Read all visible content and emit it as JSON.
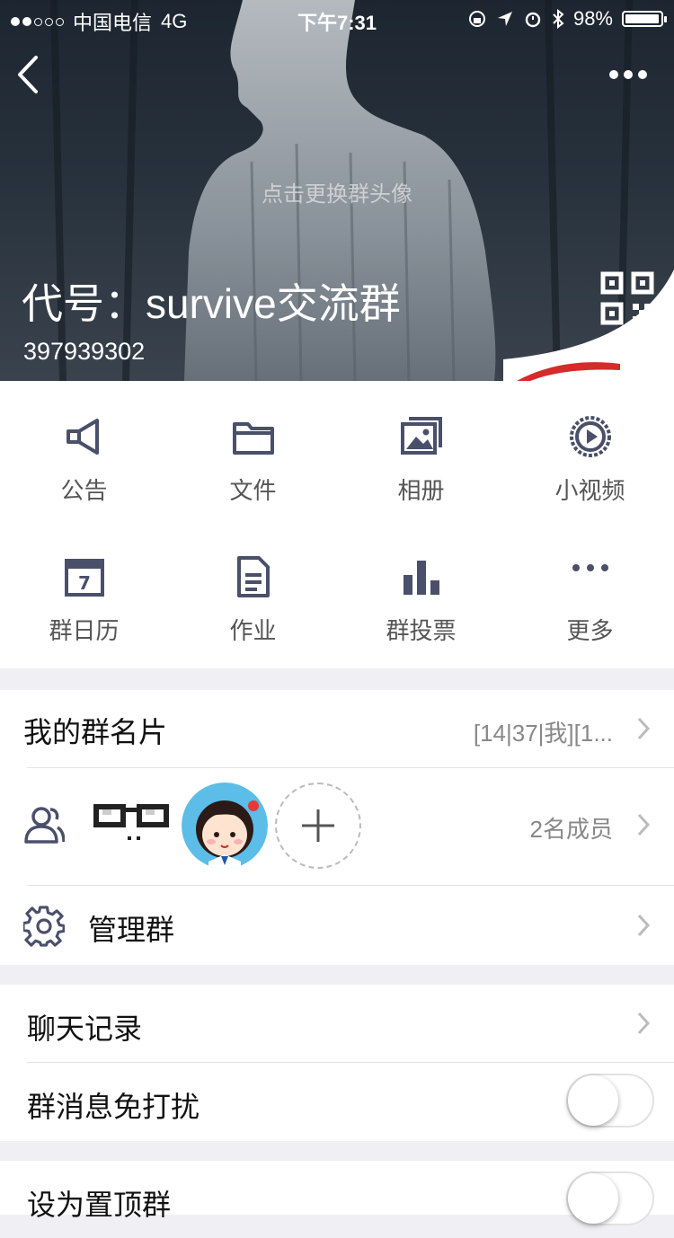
{
  "status_bar": {
    "carrier": "中国电信",
    "network": "4G",
    "time": "下午7:31",
    "battery": "98%",
    "battery_level": 0.98
  },
  "header": {
    "change_avatar_hint": "点击更换群头像",
    "group_name": "代号：survive交流群",
    "group_id": "397939302"
  },
  "feature_grid": [
    {
      "label": "公告",
      "icon": "megaphone-icon"
    },
    {
      "label": "文件",
      "icon": "folder-icon"
    },
    {
      "label": "相册",
      "icon": "photo-album-icon"
    },
    {
      "label": "小视频",
      "icon": "video-play-icon"
    },
    {
      "label": "群日历",
      "icon": "calendar-icon"
    },
    {
      "label": "作业",
      "icon": "document-icon"
    },
    {
      "label": "群投票",
      "icon": "bar-chart-icon"
    },
    {
      "label": "更多",
      "icon": "more-dots-icon"
    }
  ],
  "calendar_day": "7",
  "list": {
    "my_card_label": "我的群名片",
    "my_card_value": "[14|37|我][1...",
    "member_count": "2名成员",
    "manage_group": "管理群",
    "chat_history": "聊天记录",
    "do_not_disturb": "群消息免打扰",
    "do_not_disturb_on": false,
    "pin_group": "设为置顶群",
    "pin_group_on": false
  },
  "colors": {
    "icon_color": "#4a4f6a",
    "background": "#efeff4",
    "separator": "#e3e3e3"
  }
}
